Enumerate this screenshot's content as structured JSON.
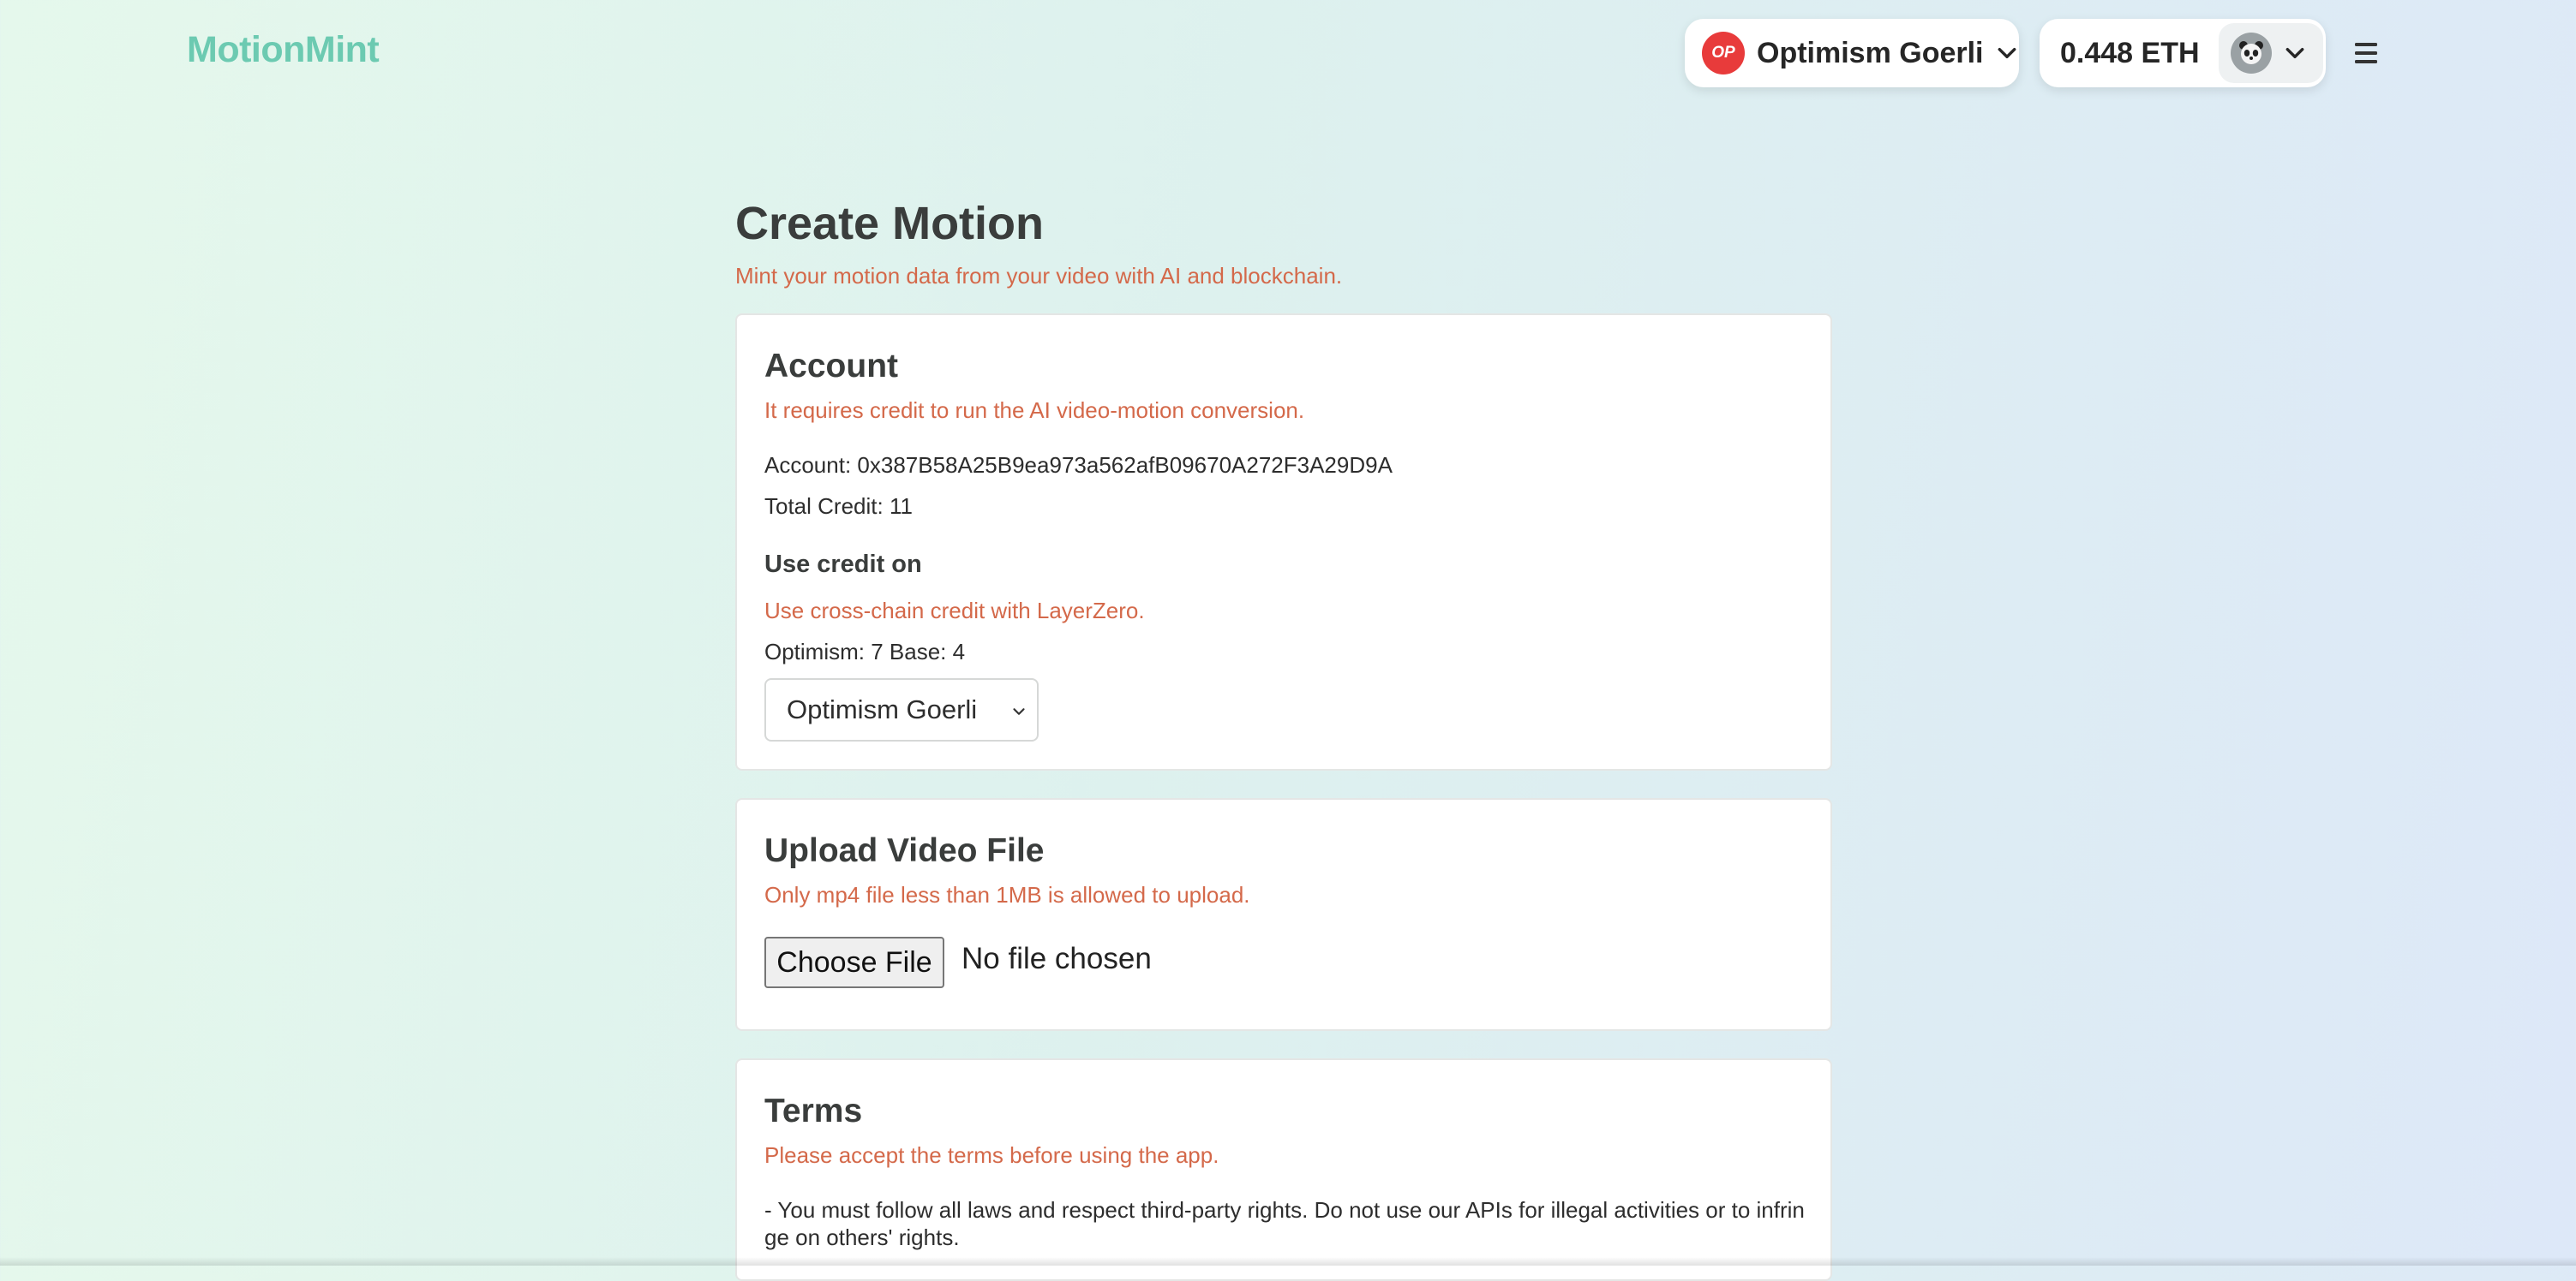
{
  "header": {
    "logo": "MotionMint",
    "network": {
      "badge": "OP",
      "name": "Optimism Goerli"
    },
    "balance": "0.448 ETH",
    "icons": {
      "chevron": "chevron-down-icon",
      "avatar": "panda-avatar-icon",
      "menu": "hamburger-menu-icon"
    }
  },
  "page": {
    "title": "Create Motion",
    "subtitle": "Mint your motion data from your video with AI and blockchain."
  },
  "account_card": {
    "title": "Account",
    "hint": "It requires credit to run the AI video-motion conversion.",
    "account_line": "Account: 0x387B58A25B9ea973a562afB09670A272F3A29D9A",
    "credit_line": "Total Credit: 11",
    "use_credit_title": "Use credit on",
    "use_credit_hint": "Use cross-chain credit with LayerZero.",
    "chain_credits": "Optimism: 7 Base: 4",
    "chain_select_value": "Optimism Goerli"
  },
  "upload_card": {
    "title": "Upload Video File",
    "hint": "Only mp4 file less than 1MB is allowed to upload.",
    "choose_label": "Choose File",
    "status": "No file chosen"
  },
  "terms_card": {
    "title": "Terms",
    "hint": "Please accept the terms before using the app.",
    "line1": "- You must follow all laws and respect third-party rights. Do not use our APIs for illegal activities or to infrin",
    "line2": "ge on others' rights."
  },
  "colors": {
    "brand": "#6ccab1",
    "hint_text": "#d4694a",
    "op_red": "#e83b3b"
  }
}
